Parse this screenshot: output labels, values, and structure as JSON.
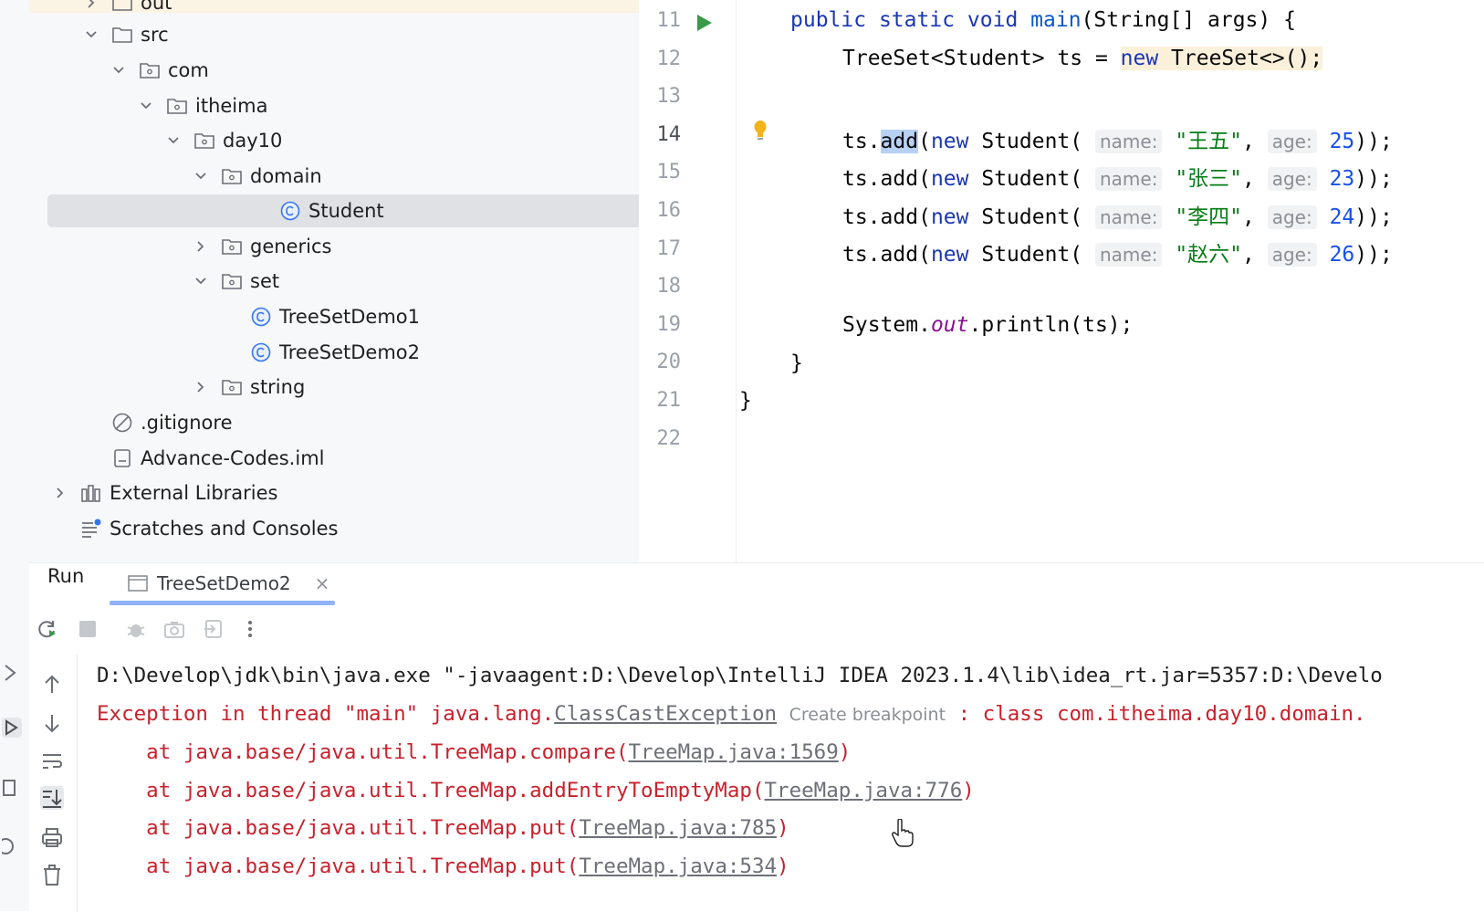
{
  "project_tree": {
    "items": [
      {
        "label": "out",
        "icon": "folder-icon",
        "expanded": false
      },
      {
        "label": "src",
        "icon": "folder-icon",
        "expanded": true
      },
      {
        "label": "com",
        "icon": "package-icon",
        "expanded": true
      },
      {
        "label": "itheima",
        "icon": "package-icon",
        "expanded": true
      },
      {
        "label": "day10",
        "icon": "package-icon",
        "expanded": true
      },
      {
        "label": "domain",
        "icon": "package-icon",
        "expanded": true
      },
      {
        "label": "Student",
        "icon": "class-icon",
        "selected": true
      },
      {
        "label": "generics",
        "icon": "package-icon",
        "expanded": false
      },
      {
        "label": "set",
        "icon": "package-icon",
        "expanded": true
      },
      {
        "label": "TreeSetDemo1",
        "icon": "class-icon"
      },
      {
        "label": "TreeSetDemo2",
        "icon": "class-icon"
      },
      {
        "label": "string",
        "icon": "package-icon",
        "expanded": false
      },
      {
        "label": ".gitignore",
        "icon": "ignored-file-icon"
      },
      {
        "label": "Advance-Codes.iml",
        "icon": "module-file-icon"
      },
      {
        "label": "External Libraries",
        "icon": "libraries-icon",
        "expanded": false
      },
      {
        "label": "Scratches and Consoles",
        "icon": "scratches-icon"
      }
    ]
  },
  "editor": {
    "line_numbers": [
      "11",
      "12",
      "13",
      "14",
      "15",
      "16",
      "17",
      "18",
      "19",
      "20",
      "21",
      "22"
    ],
    "current_line": "14",
    "main_sig": {
      "kw1": "public",
      "kw2": "static",
      "kw3": "void",
      "name": "main",
      "rest": "(String[] args) {"
    },
    "line12": {
      "decl": "TreeSet<Student> ts = ",
      "kw": "new",
      "ctor": " TreeSet<>();"
    },
    "adds": [
      {
        "pre": "ts.",
        "method": "add",
        "open": "(",
        "kw": "new",
        "cls": " Student( ",
        "name_hint": "name:",
        "name": "\"王五\"",
        "comma": ", ",
        "age_hint": "age:",
        "age": "25",
        "close": "));"
      },
      {
        "pre": "ts.",
        "method": "add",
        "open": "(",
        "kw": "new",
        "cls": " Student( ",
        "name_hint": "name:",
        "name": "\"张三\"",
        "comma": ", ",
        "age_hint": "age:",
        "age": "23",
        "close": "));"
      },
      {
        "pre": "ts.",
        "method": "add",
        "open": "(",
        "kw": "new",
        "cls": " Student( ",
        "name_hint": "name:",
        "name": "\"李四\"",
        "comma": ", ",
        "age_hint": "age:",
        "age": "24",
        "close": "));"
      },
      {
        "pre": "ts.",
        "method": "add",
        "open": "(",
        "kw": "new",
        "cls": " Student( ",
        "name_hint": "name:",
        "name": "\"赵六\"",
        "comma": ", ",
        "age_hint": "age:",
        "age": "26",
        "close": "));"
      }
    ],
    "println": {
      "pre": "System.",
      "field": "out",
      "post": ".println(ts);"
    },
    "close_method": "}",
    "close_class": "}"
  },
  "run_panel": {
    "title": "Run",
    "tab_label": "TreeSetDemo2",
    "console": {
      "cmd": "D:\\Develop\\jdk\\bin\\java.exe \"-javaagent:D:\\Develop\\IntelliJ IDEA 2023.1.4\\lib\\idea_rt.jar=5357:D:\\Develo",
      "exc_prefix": "Exception in thread \"main\" java.lang.",
      "exc_link": "ClassCastException",
      "exc_hint": "Create breakpoint",
      "exc_suffix": " : class com.itheima.day10.domain.",
      "stack": [
        {
          "at": "    at java.base/java.util.TreeMap.compare(",
          "link": "TreeMap.java:1569",
          ")": ")"
        },
        {
          "at": "    at java.base/java.util.TreeMap.addEntryToEmptyMap(",
          "link": "TreeMap.java:776",
          ")": ")"
        },
        {
          "at": "    at java.base/java.util.TreeMap.put(",
          "link": "TreeMap.java:785",
          ")": ")"
        },
        {
          "at": "    at java.base/java.util.TreeMap.put(",
          "link": "TreeMap.java:534",
          ")": ")"
        }
      ]
    }
  },
  "colors": {
    "keyword": "#1a37b5",
    "string": "#067d17",
    "number": "#1750eb",
    "error": "#c7222d",
    "selection": "#b7d1f5"
  }
}
